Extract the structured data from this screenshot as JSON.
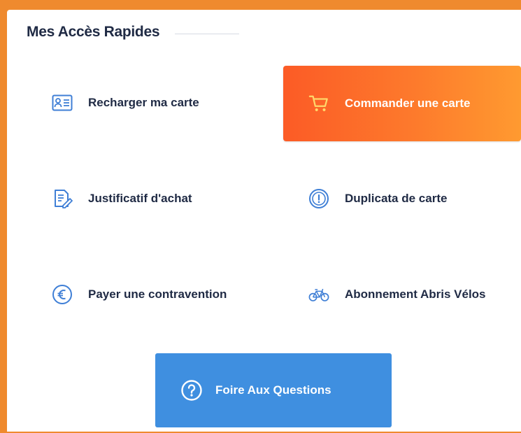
{
  "section": {
    "title": "Mes Accès Rapides"
  },
  "tiles": [
    {
      "label": "Recharger ma carte",
      "icon": "id-card-icon"
    },
    {
      "label": "Commander une carte",
      "icon": "cart-icon",
      "highlighted": true
    },
    {
      "label": "Justificatif d'achat",
      "icon": "receipt-edit-icon"
    },
    {
      "label": "Duplicata de carte",
      "icon": "info-circle-icon"
    },
    {
      "label": "Payer une contravention",
      "icon": "euro-icon"
    },
    {
      "label": "Abonnement Abris Vélos",
      "icon": "bicycle-icon"
    }
  ],
  "faq": {
    "label": "Foire Aux Questions",
    "icon": "question-circle-icon"
  },
  "colors": {
    "frame": "#ef8a2e",
    "title": "#1f2a44",
    "icon_blue": "#3f7fd6",
    "highlight_start": "#fc5b26",
    "highlight_end": "#ff9a30",
    "faq_bg": "#3f8fe0"
  }
}
